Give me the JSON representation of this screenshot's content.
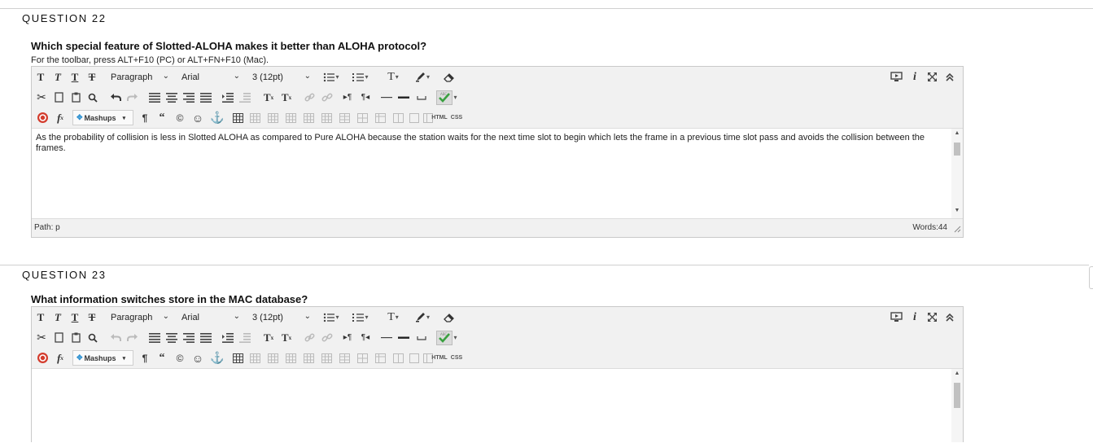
{
  "questions": [
    {
      "title": "QUESTION 22",
      "prompt": "Which special feature of Slotted-ALOHA makes it better than ALOHA protocol?",
      "hint": "For the toolbar, press ALT+F10 (PC) or ALT+FN+F10 (Mac).",
      "editor": {
        "format_select": "Paragraph",
        "font_select": "Arial",
        "size_select": "3 (12pt)",
        "mashups_label": "Mashups",
        "html_label": "HTML",
        "css_label": "CSS",
        "content": "As the probability of collision is less in Slotted ALOHA as compared to Pure ALOHA because the station waits for the next time slot to begin which lets the frame in a previous time slot pass and avoids the collision between the frames.",
        "path": "Path: p",
        "words": "Words:44"
      }
    },
    {
      "title": "QUESTION 23",
      "prompt": "What information switches store in the MAC database?",
      "editor": {
        "format_select": "Paragraph",
        "font_select": "Arial",
        "size_select": "3 (12pt)",
        "mashups_label": "Mashups",
        "html_label": "HTML",
        "css_label": "CSS",
        "content": ""
      }
    }
  ],
  "colors": {
    "accent_red": "#d33b2c",
    "check_green": "#3aa040"
  },
  "icons": [
    "bold-icon",
    "italic-icon",
    "underline-icon",
    "strikethrough-icon",
    "cut-icon",
    "copy-icon",
    "paste-icon",
    "find-icon",
    "undo-icon",
    "redo-icon",
    "align-left-icon",
    "align-center-icon",
    "align-right-icon",
    "justify-icon",
    "bullet-list-icon",
    "numbered-list-icon",
    "text-color-icon",
    "highlight-icon",
    "eraser-icon",
    "preview-icon",
    "info-icon",
    "fullscreen-icon",
    "collapse-icon",
    "outdent-icon",
    "indent-icon",
    "superscript-icon",
    "subscript-icon",
    "link-icon",
    "unlink-icon",
    "ltr-icon",
    "rtl-icon",
    "hr-icon",
    "spell-check-icon",
    "record-icon",
    "formula-icon",
    "pilcrow-icon",
    "quote-icon",
    "copyright-icon",
    "emoji-icon",
    "anchor-icon",
    "table-icon",
    "grip-icon"
  ]
}
